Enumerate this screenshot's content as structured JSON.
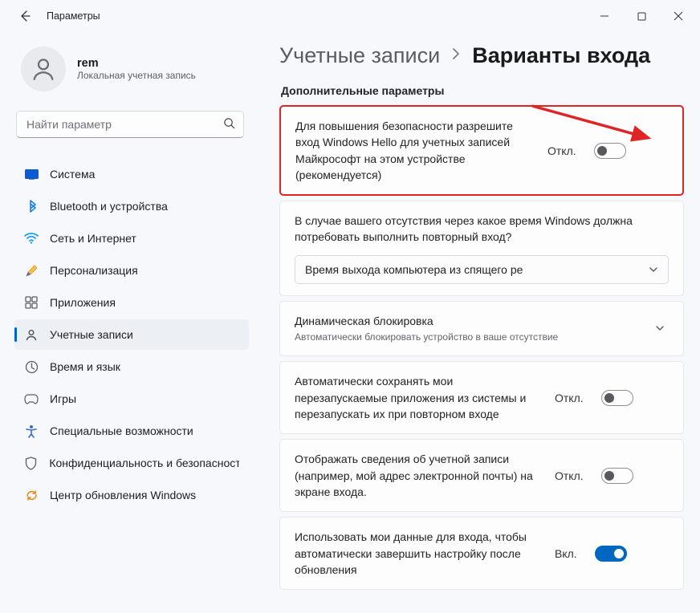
{
  "window": {
    "title": "Параметры"
  },
  "user": {
    "name": "rem",
    "subtitle": "Локальная учетная запись"
  },
  "search": {
    "placeholder": "Найти параметр"
  },
  "sidebar": {
    "items": [
      {
        "label": "Система"
      },
      {
        "label": "Bluetooth и устройства"
      },
      {
        "label": "Сеть и Интернет"
      },
      {
        "label": "Персонализация"
      },
      {
        "label": "Приложения"
      },
      {
        "label": "Учетные записи"
      },
      {
        "label": "Время и язык"
      },
      {
        "label": "Игры"
      },
      {
        "label": "Специальные возможности"
      },
      {
        "label": "Конфиденциальность и безопасность"
      },
      {
        "label": "Центр обновления Windows"
      }
    ]
  },
  "breadcrumb": {
    "parent": "Учетные записи",
    "current": "Варианты входа"
  },
  "section": {
    "title": "Дополнительные параметры"
  },
  "toggle_state": {
    "off": "Откл.",
    "on": "Вкл."
  },
  "cards": {
    "hello": {
      "text": "Для повышения безопасности разрешите вход Windows Hello для учетных записей Майкрософт на этом устройстве (рекомендуется)",
      "state": "off"
    },
    "reauth": {
      "text": "В случае вашего отсутствия через какое время Windows должна потребовать выполнить повторный вход?",
      "dropdown": "Время выхода компьютера из спящего ре"
    },
    "dynlock": {
      "title": "Динамическая блокировка",
      "sub": "Автоматически блокировать устройство в ваше отсутствие"
    },
    "restart_apps": {
      "text": "Автоматически сохранять мои перезапускаемые приложения из системы и перезапускать их при повторном входе",
      "state": "off"
    },
    "show_account": {
      "text": "Отображать сведения об учетной записи (например, мой адрес электронной почты) на экране входа.",
      "state": "off"
    },
    "use_signin": {
      "text": "Использовать мои данные для входа, чтобы автоматически завершить настройку после обновления",
      "state": "on"
    }
  }
}
